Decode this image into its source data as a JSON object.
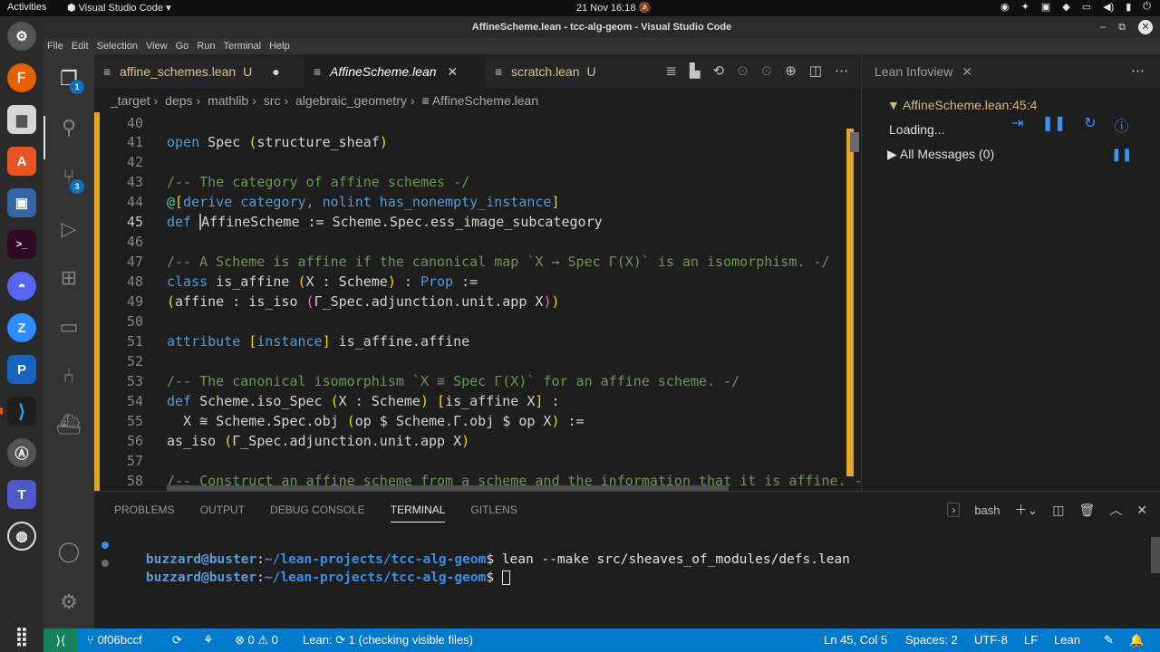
{
  "topbar": {
    "activities": "Activities",
    "app_name": "Visual Studio Code",
    "clock": "21 Nov  16:18"
  },
  "window": {
    "title": "AffineScheme.lean - tcc-alg-geom - Visual Studio Code"
  },
  "menu": [
    "File",
    "Edit",
    "Selection",
    "View",
    "Go",
    "Run",
    "Terminal",
    "Help"
  ],
  "activity_badges": {
    "explorer": "1",
    "source_control": "3"
  },
  "tabs": [
    {
      "label": "affine_schemes.lean",
      "status": "U",
      "state": "modified-inactive"
    },
    {
      "label": "AffineScheme.lean",
      "state": "active"
    },
    {
      "label": "scratch.lean",
      "status": "U",
      "state": "inactive"
    }
  ],
  "breadcrumb": [
    "_target",
    "deps",
    "mathlib",
    "src",
    "algebraic_geometry",
    "AffineScheme.lean"
  ],
  "editor": {
    "line_numbers": [
      "40",
      "41",
      "42",
      "43",
      "44",
      "45",
      "46",
      "47",
      "48",
      "49",
      "50",
      "51",
      "52",
      "53",
      "54",
      "55",
      "56",
      "57",
      "58"
    ],
    "current_line": "45"
  },
  "infoview": {
    "tab_label": "Lean Infoview",
    "file_pos": "AffineScheme.lean:45:4",
    "loading": "Loading...",
    "messages": "All Messages (0)"
  },
  "panel": {
    "tabs": [
      "PROBLEMS",
      "OUTPUT",
      "DEBUG CONSOLE",
      "TERMINAL",
      "GITLENS"
    ],
    "active_tab": "TERMINAL",
    "shell": "bash",
    "terminal": [
      {
        "user": "buzzard@buster",
        "path": "~/lean-projects/tcc-alg-geom",
        "prompt": "$",
        "command": " lean --make src/sheaves_of_modules/defs.lean"
      },
      {
        "user": "buzzard@buster",
        "path": "~/lean-projects/tcc-alg-geom",
        "prompt": "$",
        "command": " "
      }
    ]
  },
  "statusbar": {
    "branch": "0f06bccf",
    "errors": "0",
    "warnings": "0",
    "lean_status": "Lean: ⟳ 1 (checking visible files)",
    "position": "Ln 45, Col 5",
    "spaces": "Spaces: 2",
    "encoding": "UTF-8",
    "eol": "LF",
    "language": "Lean"
  },
  "colors": {
    "accent": "#007acc",
    "modified_gutter": "#e2a529",
    "remote": "#16825d"
  }
}
